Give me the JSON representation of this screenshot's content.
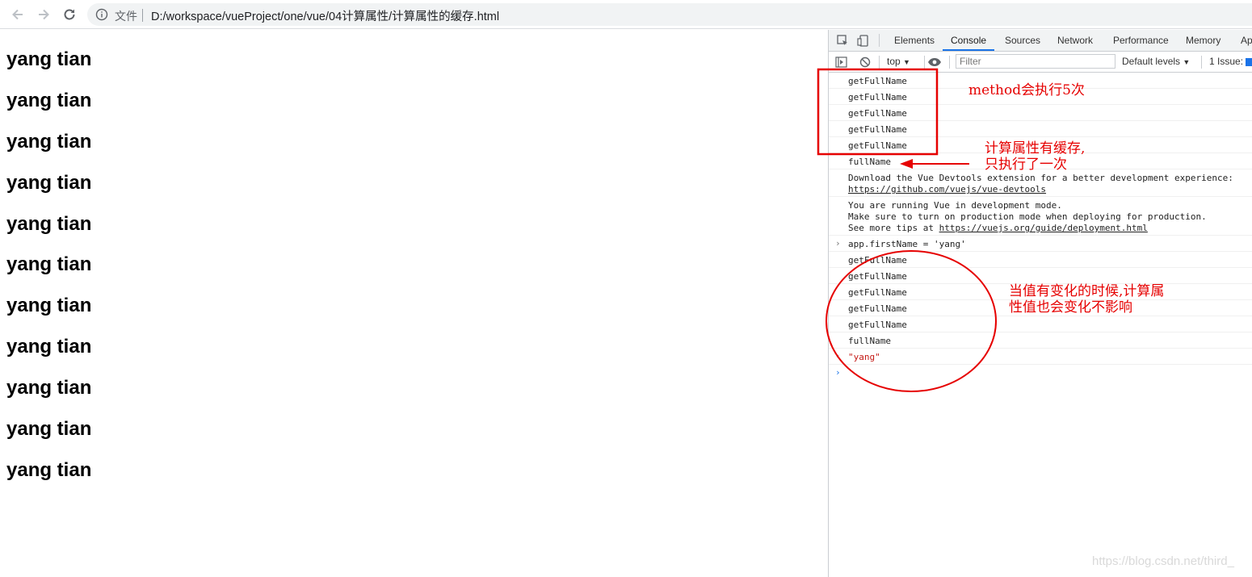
{
  "address_bar": {
    "security_label": "文件",
    "url": "D:/workspace/vueProject/one/vue/04计算属性/计算属性的缓存.html"
  },
  "page": {
    "lines": [
      "yang tian",
      "yang tian",
      "yang tian",
      "yang tian",
      "yang tian",
      "yang tian",
      "yang tian",
      "yang tian",
      "yang tian",
      "yang tian",
      "yang tian"
    ]
  },
  "devtools": {
    "tabs": [
      "Elements",
      "Console",
      "Sources",
      "Network",
      "Performance",
      "Memory",
      "Ap"
    ],
    "active_tab": "Console",
    "toolbar": {
      "context": "top",
      "filter_placeholder": "Filter",
      "levels": "Default levels",
      "issues": "1 Issue:"
    },
    "console": {
      "log1": "getFullName",
      "log2": "getFullName",
      "log3": "getFullName",
      "log4": "getFullName",
      "log5": "getFullName",
      "log6": "fullName",
      "devtools_msg": "Download the Vue Devtools extension for a better development experience:",
      "devtools_link": "https://github.com/vuejs/vue-devtools",
      "dev_mode_1": "You are running Vue in development mode.",
      "dev_mode_2": "Make sure to turn on production mode when deploying for production.",
      "dev_mode_3": "See more tips at ",
      "dev_mode_link": "https://vuejs.org/guide/deployment.html",
      "input_cmd": "app.firstName = 'yang'",
      "log7": "getFullName",
      "log8": "getFullName",
      "log9": "getFullName",
      "log10": "getFullName",
      "log11": "getFullName",
      "log12": "fullName",
      "result": "\"yang\""
    }
  },
  "annotations": {
    "method_note": "method会执行5次",
    "computed_note_1": "计算属性有缓存,",
    "computed_note_2": "只执行了一次",
    "change_note_1": "当值有变化的时候,计算属",
    "change_note_2": "性值也会变化不影响",
    "color": "#e60000"
  },
  "watermark": "https://blog.csdn.net/third_"
}
